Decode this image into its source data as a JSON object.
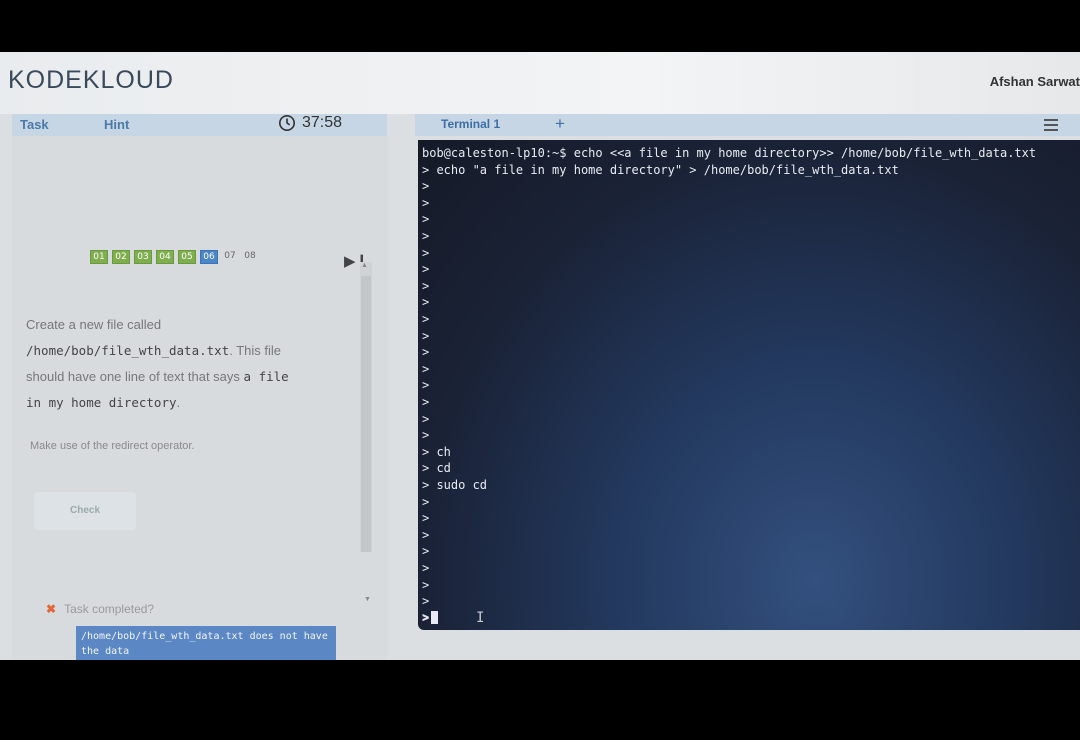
{
  "header": {
    "logo": "KODEKLOUD",
    "user": "Afshan Sarwat"
  },
  "left_panel": {
    "tabs": [
      "Task",
      "Hint"
    ],
    "timer": "37:58",
    "steps": [
      {
        "label": "01",
        "state": "done"
      },
      {
        "label": "02",
        "state": "done"
      },
      {
        "label": "03",
        "state": "done"
      },
      {
        "label": "04",
        "state": "done"
      },
      {
        "label": "05",
        "state": "done"
      },
      {
        "label": "06",
        "state": "current"
      },
      {
        "label": "07",
        "state": "todo"
      },
      {
        "label": "08",
        "state": "todo"
      }
    ],
    "task": {
      "line1": "Create a new file called",
      "path": "/home/bob/file_wth_data.txt",
      "line2_suffix": ". This file",
      "line3": "should have one line of text that says",
      "text1": "a file",
      "text2": "in my home directory",
      "line4_suffix": ".",
      "note": "Make use of the redirect operator."
    },
    "check_label": "Check",
    "status": "Task completed?",
    "error": "/home/bob/file_wth_data.txt does not have the data"
  },
  "terminal": {
    "tab": "Terminal 1",
    "add": "+",
    "lines": [
      "bob@caleston-lp10:~$ echo <<a file in my home directory>> /home/bob/file_wth_data.txt",
      "> echo \"a file in my home directory\" > /home/bob/file_wth_data.txt",
      ">",
      ">",
      ">",
      ">",
      ">",
      ">",
      ">",
      ">",
      ">",
      ">",
      ">",
      ">",
      ">",
      ">",
      ">",
      ">",
      "> ch",
      "> cd",
      "> sudo cd",
      ">",
      ">",
      ">",
      ">",
      ">",
      ">",
      ">",
      ">"
    ],
    "prompt": ">"
  },
  "colors": {
    "step_done": "#7fae4e",
    "step_current": "#4a86c8",
    "error_bg": "#5b87c4",
    "terminal_bg": "#1a2236"
  }
}
